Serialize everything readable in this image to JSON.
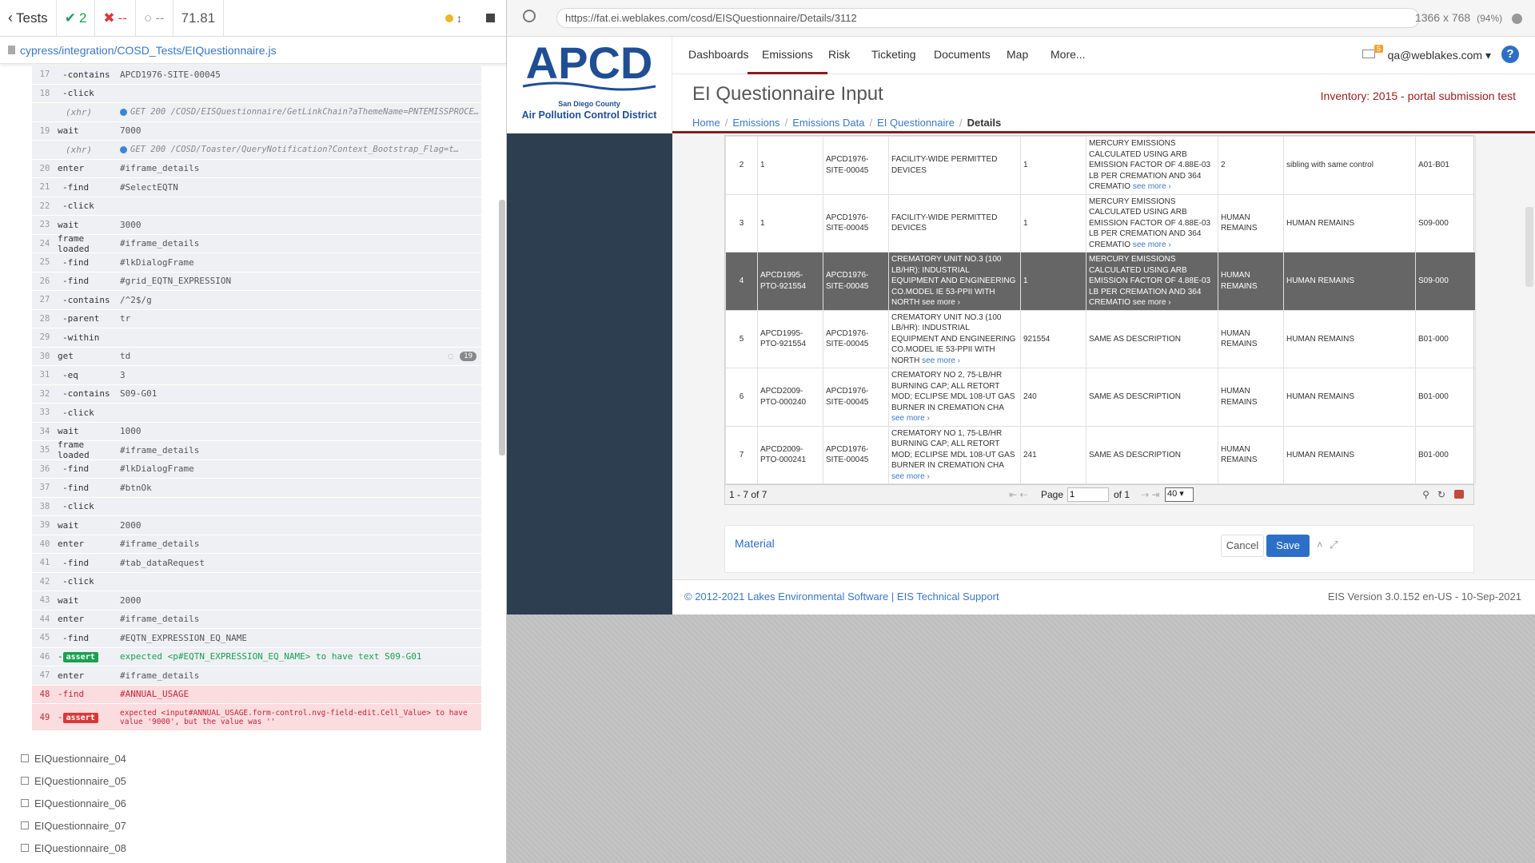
{
  "runner": {
    "back_label": "Tests",
    "passed": "2",
    "failed": "--",
    "pending": "--",
    "duration": "71.81",
    "spec_path": "cypress/integration/COSD_Tests/EIQuestionnaire.js",
    "commands": [
      {
        "num": "17",
        "name": "-contains",
        "msg": "APCD1976-SITE-00045",
        "kind": "child"
      },
      {
        "num": "18",
        "name": "-click",
        "msg": "",
        "kind": "child"
      },
      {
        "num": "",
        "name": "(xhr)",
        "msg": "GET 200 /COSD/EISQuestionnaire/GetLinkChain?aThemeName=PNTEMISSPROCESS&anEnt…",
        "kind": "xhr"
      },
      {
        "num": "19",
        "name": "wait",
        "msg": "7000",
        "kind": "parent"
      },
      {
        "num": "",
        "name": "(xhr)",
        "msg": "GET 200 /COSD/Toaster/QueryNotification?Context_Bootstrap_Flag=t…",
        "kind": "xhr"
      },
      {
        "num": "20",
        "name": "enter",
        "msg": "#iframe_details",
        "kind": "parent"
      },
      {
        "num": "21",
        "name": "-find",
        "msg": "#SelectEQTN",
        "kind": "child"
      },
      {
        "num": "22",
        "name": "-click",
        "msg": "",
        "kind": "child"
      },
      {
        "num": "23",
        "name": "wait",
        "msg": "3000",
        "kind": "parent"
      },
      {
        "num": "24",
        "name": "frame loaded",
        "msg": "#iframe_details",
        "kind": "parent"
      },
      {
        "num": "25",
        "name": "-find",
        "msg": "#lkDialogFrame",
        "kind": "child"
      },
      {
        "num": "26",
        "name": "-find",
        "msg": "#grid_EQTN_EXPRESSION",
        "kind": "child"
      },
      {
        "num": "27",
        "name": "-contains",
        "msg": "/^2$/g",
        "kind": "child"
      },
      {
        "num": "28",
        "name": "-parent",
        "msg": "tr",
        "kind": "child"
      },
      {
        "num": "29",
        "name": "-within",
        "msg": "",
        "kind": "child"
      },
      {
        "num": "30",
        "name": "get",
        "msg": "td",
        "kind": "parent",
        "count": "19"
      },
      {
        "num": "31",
        "name": "-eq",
        "msg": "3",
        "kind": "child"
      },
      {
        "num": "32",
        "name": "-contains",
        "msg": "S09-G01",
        "kind": "child"
      },
      {
        "num": "33",
        "name": "-click",
        "msg": "",
        "kind": "child"
      },
      {
        "num": "34",
        "name": "wait",
        "msg": "1000",
        "kind": "parent"
      },
      {
        "num": "35",
        "name": "frame loaded",
        "msg": "#iframe_details",
        "kind": "parent"
      },
      {
        "num": "36",
        "name": "-find",
        "msg": "#lkDialogFrame",
        "kind": "child"
      },
      {
        "num": "37",
        "name": "-find",
        "msg": "#btnOk",
        "kind": "child"
      },
      {
        "num": "38",
        "name": "-click",
        "msg": "",
        "kind": "child"
      },
      {
        "num": "39",
        "name": "wait",
        "msg": "2000",
        "kind": "parent"
      },
      {
        "num": "40",
        "name": "enter",
        "msg": "#iframe_details",
        "kind": "parent"
      },
      {
        "num": "41",
        "name": "-find",
        "msg": "#tab_dataRequest",
        "kind": "child"
      },
      {
        "num": "42",
        "name": "-click",
        "msg": "",
        "kind": "child"
      },
      {
        "num": "43",
        "name": "wait",
        "msg": "2000",
        "kind": "parent"
      },
      {
        "num": "44",
        "name": "enter",
        "msg": "#iframe_details",
        "kind": "parent"
      },
      {
        "num": "45",
        "name": "-find",
        "msg": "#EQTN_EXPRESSION_EQ_NAME",
        "kind": "child"
      },
      {
        "num": "46",
        "name": "-assert",
        "msg": "expected <p#EQTN_EXPRESSION_EQ_NAME> to have text S09-G01",
        "kind": "assert-ok"
      },
      {
        "num": "47",
        "name": "enter",
        "msg": "#iframe_details",
        "kind": "parent"
      },
      {
        "num": "48",
        "name": "-find",
        "msg": "#ANNUAL_USAGE",
        "kind": "failed"
      },
      {
        "num": "49",
        "name": "-assert",
        "msg": "expected <input#ANNUAL_USAGE.form-control.nvg-field-edit.Cell_Value> to have value '9000', but the value was ''",
        "kind": "failed"
      }
    ],
    "tests": [
      "EIQuestionnaire_04",
      "EIQuestionnaire_05",
      "EIQuestionnaire_06",
      "EIQuestionnaire_07",
      "EIQuestionnaire_08"
    ]
  },
  "browser": {
    "url": "https://fat.ei.weblakes.com/cosd/EISQuestionnaire/Details/3112",
    "viewport": "1366 x 768",
    "zoom": "(94%)"
  },
  "app": {
    "logo_text": "APCD",
    "logo_sub1": "San Diego County",
    "logo_sub2": "Air Pollution Control District",
    "nav": [
      "Dashboards",
      "Emissions",
      "Risk",
      "Ticketing",
      "Documents",
      "Map",
      "More..."
    ],
    "notification_count": "5",
    "user": "qa@weblakes.com",
    "page_title": "EI Questionnaire Input",
    "inventory": "Inventory: 2015 - portal submission test",
    "breadcrumbs": [
      "Home",
      "Emissions",
      "Emissions Data",
      "EI Questionnaire",
      "Details"
    ],
    "rows": [
      {
        "n": "2",
        "c1": "1",
        "c2": "APCD1976-SITE-00045",
        "c3": "FACILITY-WIDE PERMITTED DEVICES",
        "c4": "1",
        "c5": "MERCURY EMISSIONS CALCULATED USING ARB EMISSION FACTOR OF 4.88E-03 LB PER CREMATION AND 364 CREMATIO",
        "c6": "2",
        "c7": "sibling with same control",
        "c8": "A01-B01",
        "sel": false
      },
      {
        "n": "3",
        "c1": "1",
        "c2": "APCD1976-SITE-00045",
        "c3": "FACILITY-WIDE PERMITTED DEVICES",
        "c4": "1",
        "c5": "MERCURY EMISSIONS CALCULATED USING ARB EMISSION FACTOR OF 4.88E-03 LB PER CREMATION AND 364 CREMATIO",
        "c6": "HUMAN REMAINS",
        "c7": "HUMAN REMAINS",
        "c8": "S09-000",
        "sel": false
      },
      {
        "n": "4",
        "c1": "APCD1995-PTO-921554",
        "c2": "APCD1976-SITE-00045",
        "c3": "CREMATORY UNIT NO.3 (100 LB/HR): INDUSTRIAL EQUIPMENT AND ENGINEERING CO.MODEL IE 53-PPII WITH NORTH",
        "c4": "1",
        "c5": "MERCURY EMISSIONS CALCULATED USING ARB EMISSION FACTOR OF 4.88E-03 LB PER CREMATION AND 364 CREMATIO",
        "c6": "HUMAN REMAINS",
        "c7": "HUMAN REMAINS",
        "c8": "S09-000",
        "sel": true
      },
      {
        "n": "5",
        "c1": "APCD1995-PTO-921554",
        "c2": "APCD1976-SITE-00045",
        "c3": "CREMATORY UNIT NO.3 (100 LB/HR): INDUSTRIAL EQUIPMENT AND ENGINEERING CO.MODEL IE 53-PPII WITH NORTH",
        "c4": "921554",
        "c5": "SAME AS DESCRIPTION",
        "c6": "HUMAN REMAINS",
        "c7": "HUMAN REMAINS",
        "c8": "B01-000",
        "sel": false
      },
      {
        "n": "6",
        "c1": "APCD2009-PTO-000240",
        "c2": "APCD1976-SITE-00045",
        "c3": "CREMATORY NO 2, 75-LB/HR BURNING CAP; ALL RETORT MOD; ECLIPSE MDL 108-UT GAS BURNER IN CREMATION CHA",
        "c4": "240",
        "c5": "SAME AS DESCRIPTION",
        "c6": "HUMAN REMAINS",
        "c7": "HUMAN REMAINS",
        "c8": "B01-000",
        "sel": false
      },
      {
        "n": "7",
        "c1": "APCD2009-PTO-000241",
        "c2": "APCD1976-SITE-00045",
        "c3": "CREMATORY NO 1, 75-LB/HR BURNING CAP; ALL RETORT MOD; ECLIPSE MDL 108-UT GAS BURNER IN CREMATION CHA",
        "c4": "241",
        "c5": "SAME AS DESCRIPTION",
        "c6": "HUMAN REMAINS",
        "c7": "HUMAN REMAINS",
        "c8": "B01-000",
        "sel": false
      }
    ],
    "see_more": "see more ›",
    "pager_summary": "1 - 7 of 7",
    "page_label": "Page",
    "page_value": "1",
    "of_label": "of 1",
    "page_size": "40",
    "material_label": "Material",
    "cancel_label": "Cancel",
    "save_label": "Save",
    "footer_left": "© 2012-2021 Lakes Environmental Software",
    "footer_link": "EIS Technical Support",
    "footer_right": "EIS Version 3.0.152 en-US - 10-Sep-2021"
  }
}
